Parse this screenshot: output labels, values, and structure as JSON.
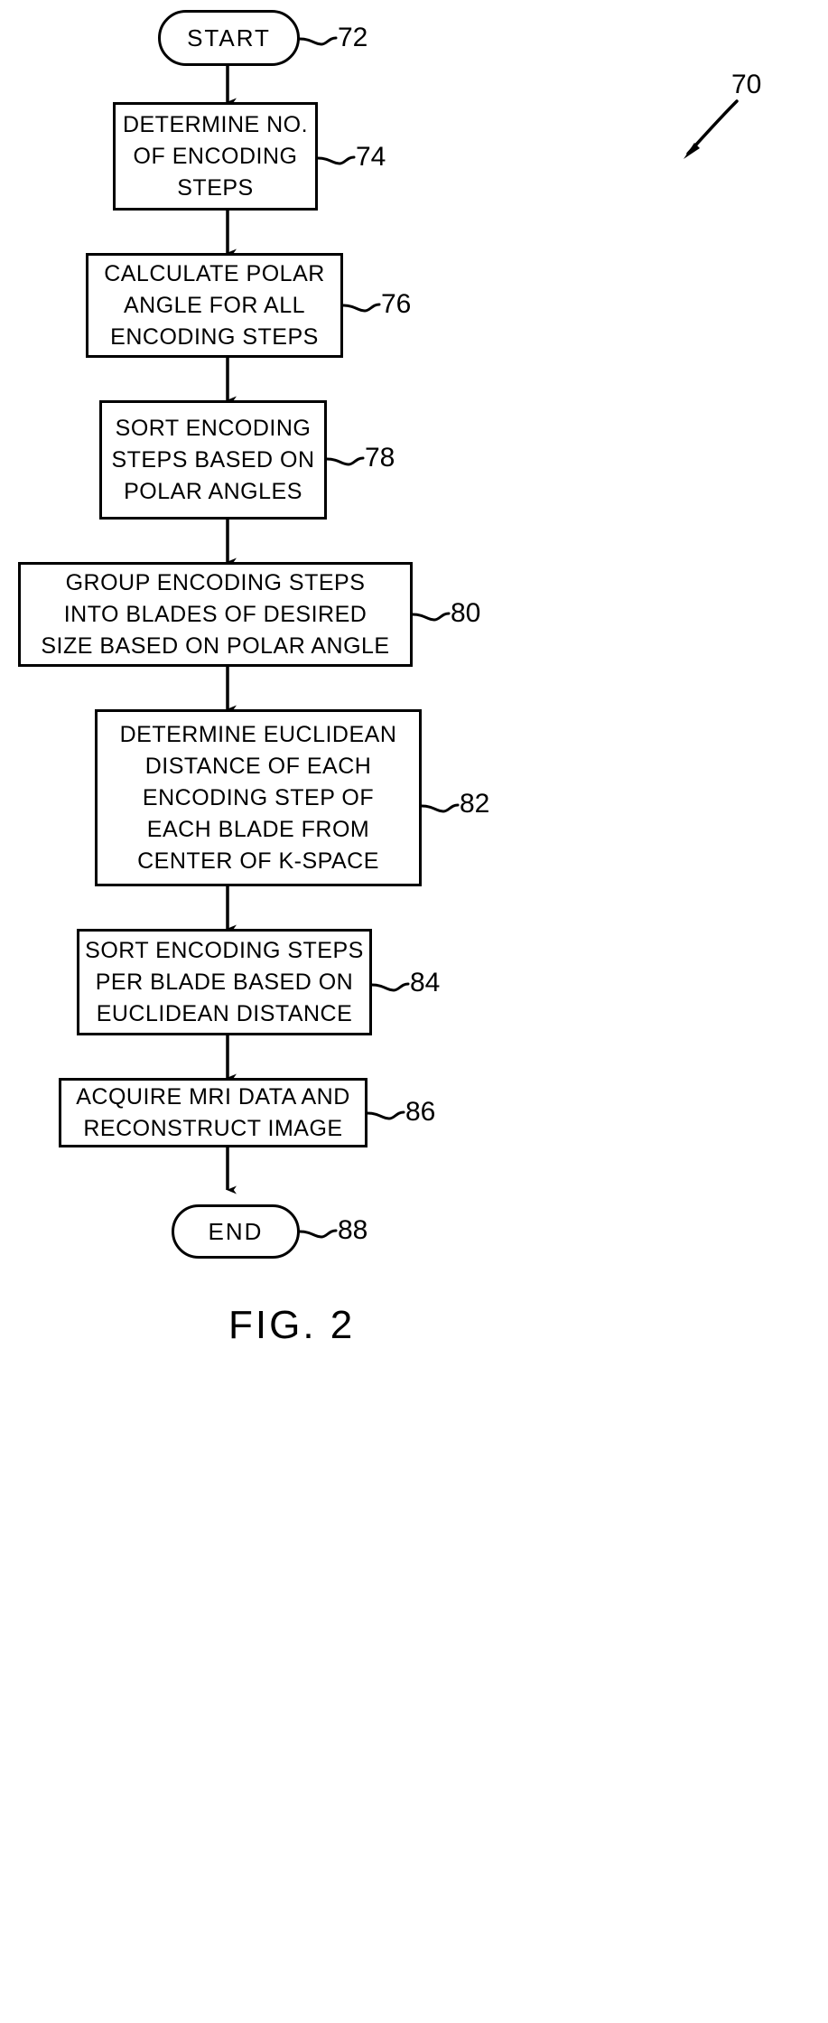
{
  "figure": {
    "caption": "FIG. 2",
    "diagram_ref": "70"
  },
  "nodes": [
    {
      "id": "start",
      "type": "terminal",
      "ref": "72",
      "lines": [
        "START"
      ]
    },
    {
      "id": "determine-encoding-steps",
      "type": "process",
      "ref": "74",
      "lines": [
        "DETERMINE NO.",
        "OF ENCODING",
        "STEPS"
      ]
    },
    {
      "id": "calculate-polar-angle",
      "type": "process",
      "ref": "76",
      "lines": [
        "CALCULATE POLAR",
        "ANGLE FOR ALL",
        "ENCODING STEPS"
      ]
    },
    {
      "id": "sort-by-polar-angles",
      "type": "process",
      "ref": "78",
      "lines": [
        "SORT ENCODING",
        "STEPS BASED ON",
        "POLAR ANGLES"
      ]
    },
    {
      "id": "group-into-blades",
      "type": "process",
      "ref": "80",
      "lines": [
        "GROUP ENCODING STEPS",
        "INTO BLADES OF DESIRED",
        "SIZE BASED ON POLAR ANGLE"
      ]
    },
    {
      "id": "determine-euclidean-distance",
      "type": "process",
      "ref": "82",
      "lines": [
        "DETERMINE EUCLIDEAN",
        "DISTANCE OF EACH",
        "ENCODING STEP OF",
        "EACH BLADE FROM",
        "CENTER OF K-SPACE"
      ]
    },
    {
      "id": "sort-per-blade",
      "type": "process",
      "ref": "84",
      "lines": [
        "SORT ENCODING STEPS",
        "PER BLADE BASED ON",
        "EUCLIDEAN DISTANCE"
      ]
    },
    {
      "id": "acquire-and-reconstruct",
      "type": "process",
      "ref": "86",
      "lines": [
        "ACQUIRE MRI DATA AND",
        "RECONSTRUCT IMAGE"
      ]
    },
    {
      "id": "end",
      "type": "terminal",
      "ref": "88",
      "lines": [
        "END"
      ]
    }
  ],
  "colors": {
    "ink": "#000000",
    "paper": "#ffffff"
  }
}
